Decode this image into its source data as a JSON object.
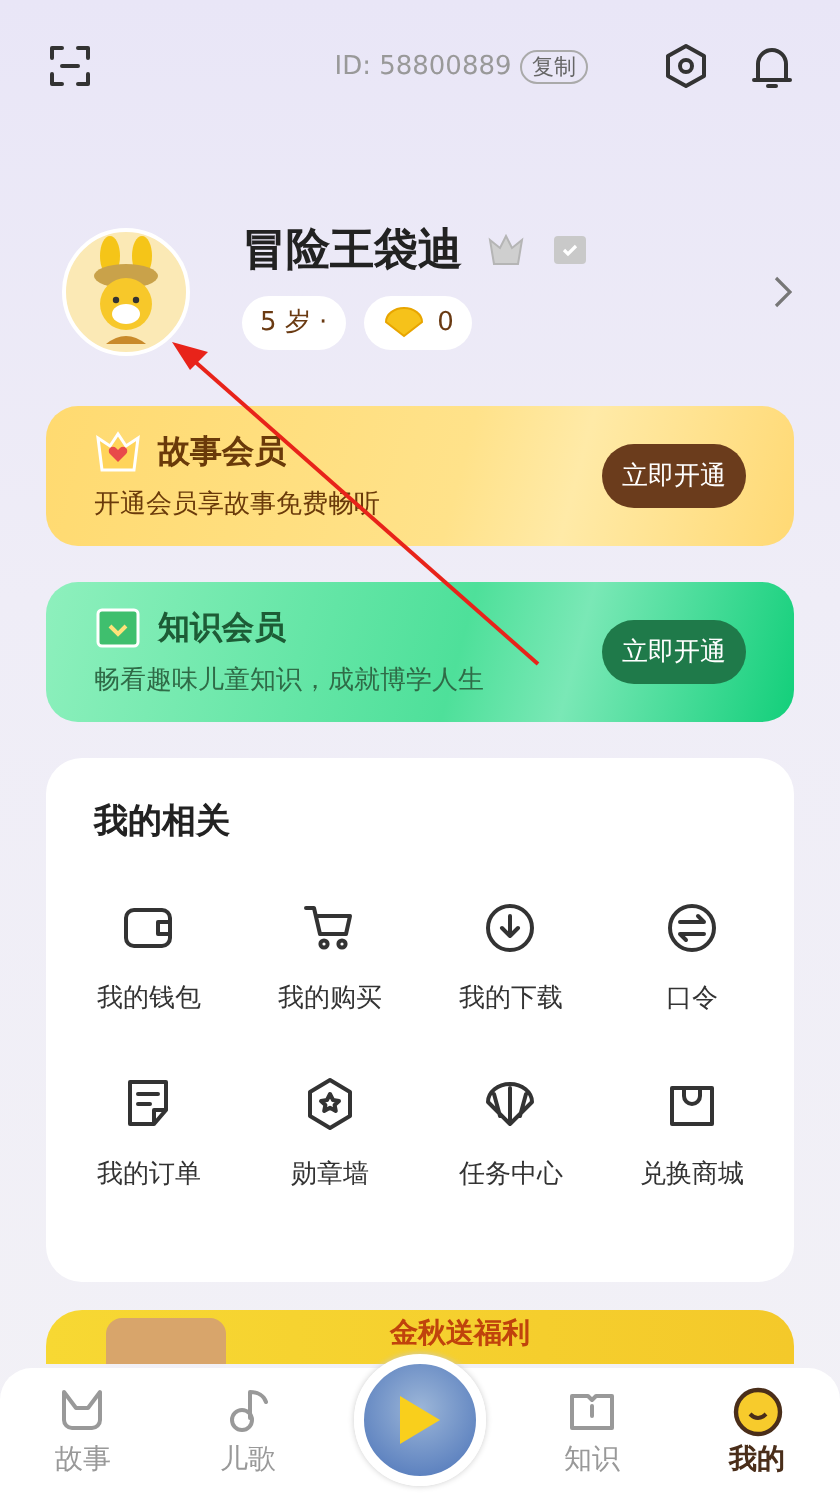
{
  "header": {
    "id_text": "ID: 58800889",
    "copy_button": "复制"
  },
  "profile": {
    "name": "冒险王袋迪",
    "age": "5 岁 ·",
    "shells": "0"
  },
  "memberships": [
    {
      "kind": "story",
      "title": "故事会员",
      "desc": "开通会员享故事免费畅听",
      "button": "立即开通"
    },
    {
      "kind": "knowledge",
      "title": "知识会员",
      "desc": "畅看趣味儿童知识，成就博学人生",
      "button": "立即开通"
    }
  ],
  "related": {
    "title": "我的相关",
    "items": [
      {
        "label": "我的钱包"
      },
      {
        "label": "我的购买"
      },
      {
        "label": "我的下载"
      },
      {
        "label": "口令"
      },
      {
        "label": "我的订单"
      },
      {
        "label": "勋章墙"
      },
      {
        "label": "任务中心"
      },
      {
        "label": "兑换商城"
      }
    ]
  },
  "banner": {
    "headline": "金秋送福利"
  },
  "tab_bar": [
    {
      "kind": "tab",
      "label": "故事",
      "selected": false
    },
    {
      "kind": "tab",
      "label": "儿歌",
      "selected": false
    },
    {
      "kind": "player"
    },
    {
      "kind": "tab",
      "label": "知识",
      "selected": false
    },
    {
      "kind": "tab",
      "label": "我的",
      "selected": true
    }
  ]
}
